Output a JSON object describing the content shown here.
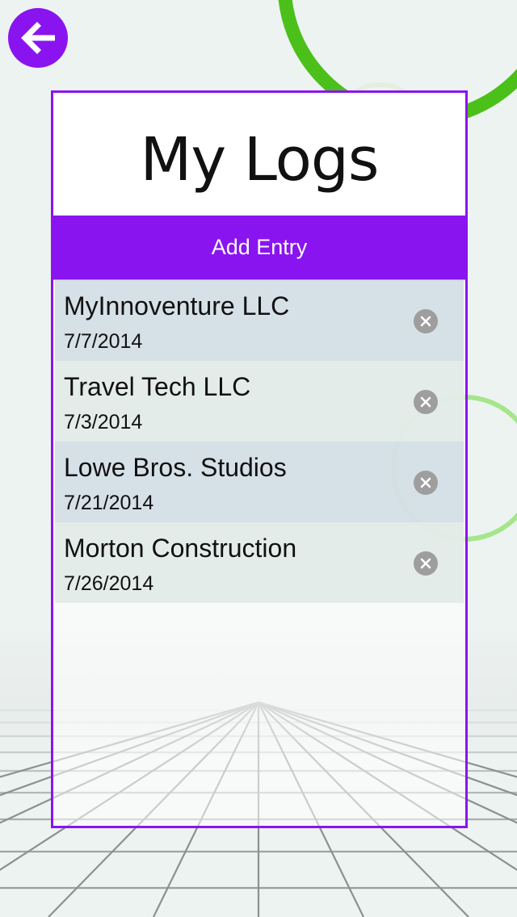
{
  "nav": {
    "back_icon": "arrow-left-circle-icon"
  },
  "panel": {
    "title": "My Logs",
    "add_entry_label": "Add Entry"
  },
  "logs": [
    {
      "name": "MyInnoventure LLC",
      "date": "7/7/2014",
      "delete_icon": "clear-circle-icon"
    },
    {
      "name": "Travel Tech LLC",
      "date": "7/3/2014",
      "delete_icon": "clear-circle-icon"
    },
    {
      "name": "Lowe Bros. Studios",
      "date": "7/21/2014",
      "delete_icon": "clear-circle-icon"
    },
    {
      "name": "Morton Construction",
      "date": "7/26/2014",
      "delete_icon": "clear-circle-icon"
    }
  ],
  "colors": {
    "accent": "#8a14f0",
    "ring": "#4cc01a",
    "background": "#edf3f1"
  }
}
